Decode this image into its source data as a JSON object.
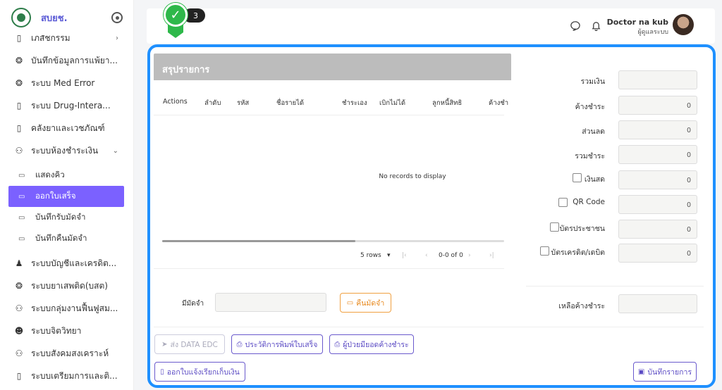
{
  "brand": {
    "name": "สบยช."
  },
  "sidebar": {
    "items": [
      {
        "label": "เภสัชกรรม",
        "icon": "▯",
        "chev": "›"
      },
      {
        "label": "บันทึกข้อมูลการแพ้ยา...",
        "icon": "❂"
      },
      {
        "label": "ระบบ Med Error",
        "icon": "❂"
      },
      {
        "label": "ระบบ Drug-Intera...",
        "icon": "▯"
      },
      {
        "label": "คลังยาและเวชภัณฑ์",
        "icon": "▯"
      },
      {
        "label": "ระบบห้องชำระเงิน",
        "icon": "⚇",
        "chev": "⌄"
      }
    ],
    "subitems": [
      {
        "label": "แสดงคิว",
        "icon": "▭"
      },
      {
        "label": "ออกใบเสร็จ",
        "icon": "▭"
      },
      {
        "label": "บันทึกรับมัดจำ",
        "icon": "▭"
      },
      {
        "label": "บันทึกคืนมัดจำ",
        "icon": "▭"
      }
    ],
    "items2": [
      {
        "label": "ระบบบัญชีและเครดิต...",
        "icon": "♟"
      },
      {
        "label": "ระบบยาเสพติด(บสต)",
        "icon": "❂"
      },
      {
        "label": "ระบบกลุ่มงานฟื้นฟูสม...",
        "icon": "⚇"
      },
      {
        "label": "ระบบจิตวิทยา",
        "icon": "☻"
      },
      {
        "label": "ระบบสังคมสงเคราะห์",
        "icon": "⚇"
      },
      {
        "label": "ระบบเตรียมการและติ...",
        "icon": "▯"
      }
    ]
  },
  "topbar": {
    "badge_count": "3",
    "user_name": "Doctor na kub",
    "user_role": "ผู้ดูแลระบบ",
    "chat_icon": "chat-icon",
    "bell_icon": "bell-icon"
  },
  "summary": {
    "title": "สรุปรายการ",
    "columns": [
      "Actions",
      "ลำดับ",
      "รหัส",
      "ชื่อรายได้",
      "ชำระเอง",
      "เบิกไม่ได้",
      "ลูกหนี้สิทธิ",
      "ค้างชำ"
    ],
    "empty_text": "No records to display",
    "pager": {
      "rows": "5 rows",
      "range": "0-0 of 0"
    }
  },
  "deposit": {
    "label": "มีมัดจำ",
    "return_button": "คืนมัดจำ"
  },
  "buttons": {
    "send_edc": "ส่ง DATA EDC",
    "print_history": "ประวัติการพิมพ์ใบเสร็จ",
    "outstanding_patients": "ผู้ป่วยมียอดค้างชำระ",
    "issue_invoice": "ออกใบแจ้งเรียกเก็บเงิน",
    "save": "บันทึกรายการ"
  },
  "payment": {
    "total_label": "รวมเงิน",
    "total_value": "",
    "outstanding_label": "ค้างชำระ",
    "outstanding_value": "0",
    "discount_label": "ส่วนลด",
    "discount_value": "0",
    "total_paid_label": "รวมชำระ",
    "total_paid_value": "0",
    "cash_label": "เงินสด",
    "cash_value": "0",
    "qr_label": "QR Code",
    "qr_value": "0",
    "idcard_label": "บัตรประชาชน",
    "idcard_value": "0",
    "credit_label": "บัตรเครดิต/เดบิต",
    "credit_value": "0",
    "remaining_label": "เหลือค้างชำระ",
    "remaining_value": ""
  }
}
